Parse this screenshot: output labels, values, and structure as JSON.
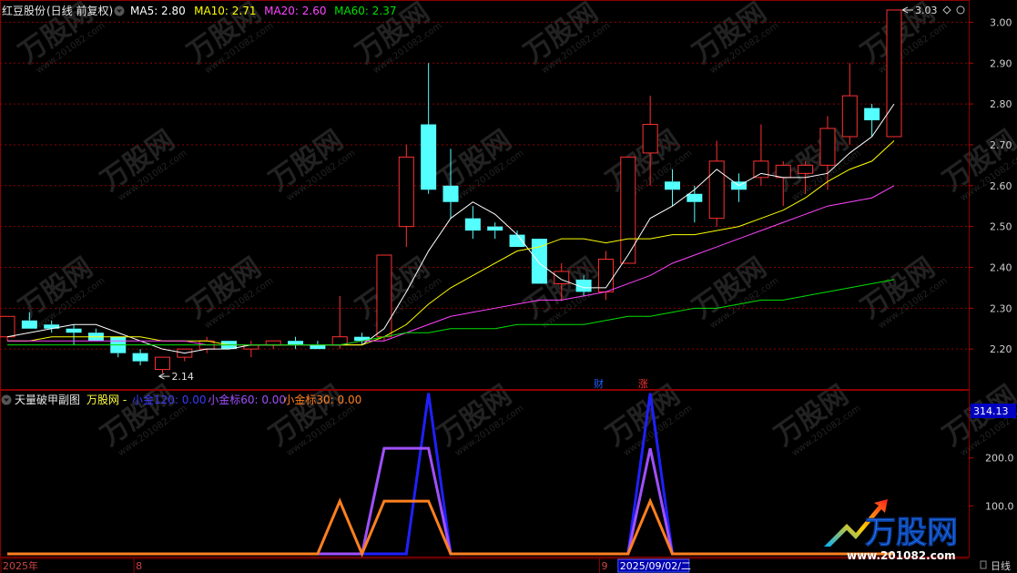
{
  "main_panel": {
    "stock_name": "红豆股份",
    "period_label": "(日线 前复权)",
    "ma_labels": [
      {
        "text": "MA5: 2.80",
        "color": "#ffffff"
      },
      {
        "text": "MA10: 2.71",
        "color": "#ffff00"
      },
      {
        "text": "MA20: 2.60",
        "color": "#ff44ff"
      },
      {
        "text": "MA60: 2.37",
        "color": "#00e000"
      }
    ],
    "high_marker": "3.03",
    "low_marker": "2.14",
    "event_badges": [
      {
        "text": "财",
        "candle_index": 26,
        "color": "#2060ff"
      },
      {
        "text": "涨",
        "candle_index": 28,
        "color": "#ff3030"
      }
    ]
  },
  "sub_panel": {
    "title": "天量破甲副图",
    "source": "万股网 -",
    "series_labels": [
      {
        "text": "小金120: 0.00",
        "color": "#3a3aff"
      },
      {
        "text": "小金标60: 0.00",
        "color": "#a050ff"
      },
      {
        "text": "小金标30: 0.00",
        "color": "#ff8020"
      }
    ],
    "value_badge": "314.13"
  },
  "x_axis": {
    "labels": [
      {
        "text": "2025年",
        "candle_index": 0
      },
      {
        "text": "8",
        "candle_index": 6
      },
      {
        "text": "9",
        "candle_index": 27
      }
    ],
    "cursor_label": "2025/09/02/二",
    "cursor_index": 28,
    "period_tag": "日线"
  },
  "watermark": {
    "brand": "万股网",
    "url": "www.201082.com"
  },
  "colors": {
    "up": "#ff3030",
    "down": "#54ffff",
    "grid": "#8b0000",
    "axis_text": "#d0d0d0"
  },
  "chart_data": [
    {
      "type": "candlestick",
      "title": "",
      "ylim": [
        2.1,
        3.05
      ],
      "y_ticks": [
        2.2,
        2.3,
        2.4,
        2.5,
        2.6,
        2.7,
        2.8,
        2.9,
        3.0
      ],
      "candles": [
        {
          "o": 2.23,
          "h": 2.28,
          "l": 2.22,
          "c": 2.28
        },
        {
          "o": 2.27,
          "h": 2.29,
          "l": 2.25,
          "c": 2.25
        },
        {
          "o": 2.26,
          "h": 2.27,
          "l": 2.24,
          "c": 2.25
        },
        {
          "o": 2.25,
          "h": 2.26,
          "l": 2.21,
          "c": 2.24
        },
        {
          "o": 2.24,
          "h": 2.25,
          "l": 2.22,
          "c": 2.22
        },
        {
          "o": 2.23,
          "h": 2.23,
          "l": 2.18,
          "c": 2.19
        },
        {
          "o": 2.19,
          "h": 2.2,
          "l": 2.16,
          "c": 2.17
        },
        {
          "o": 2.15,
          "h": 2.18,
          "l": 2.14,
          "c": 2.18
        },
        {
          "o": 2.18,
          "h": 2.2,
          "l": 2.17,
          "c": 2.2
        },
        {
          "o": 2.2,
          "h": 2.23,
          "l": 2.19,
          "c": 2.22
        },
        {
          "o": 2.22,
          "h": 2.22,
          "l": 2.2,
          "c": 2.2
        },
        {
          "o": 2.2,
          "h": 2.22,
          "l": 2.18,
          "c": 2.21
        },
        {
          "o": 2.21,
          "h": 2.22,
          "l": 2.2,
          "c": 2.22
        },
        {
          "o": 2.22,
          "h": 2.23,
          "l": 2.2,
          "c": 2.21
        },
        {
          "o": 2.21,
          "h": 2.22,
          "l": 2.2,
          "c": 2.2
        },
        {
          "o": 2.21,
          "h": 2.33,
          "l": 2.2,
          "c": 2.23
        },
        {
          "o": 2.23,
          "h": 2.24,
          "l": 2.21,
          "c": 2.22
        },
        {
          "o": 2.23,
          "h": 2.43,
          "l": 2.22,
          "c": 2.43
        },
        {
          "o": 2.5,
          "h": 2.7,
          "l": 2.45,
          "c": 2.67
        },
        {
          "o": 2.75,
          "h": 2.9,
          "l": 2.58,
          "c": 2.59
        },
        {
          "o": 2.6,
          "h": 2.69,
          "l": 2.52,
          "c": 2.56
        },
        {
          "o": 2.52,
          "h": 2.55,
          "l": 2.47,
          "c": 2.49
        },
        {
          "o": 2.5,
          "h": 2.51,
          "l": 2.47,
          "c": 2.49
        },
        {
          "o": 2.48,
          "h": 2.49,
          "l": 2.45,
          "c": 2.45
        },
        {
          "o": 2.47,
          "h": 2.47,
          "l": 2.36,
          "c": 2.36
        },
        {
          "o": 2.36,
          "h": 2.41,
          "l": 2.32,
          "c": 2.39
        },
        {
          "o": 2.37,
          "h": 2.38,
          "l": 2.33,
          "c": 2.34
        },
        {
          "o": 2.34,
          "h": 2.44,
          "l": 2.32,
          "c": 2.42
        },
        {
          "o": 2.41,
          "h": 2.67,
          "l": 2.41,
          "c": 2.67
        },
        {
          "o": 2.68,
          "h": 2.82,
          "l": 2.6,
          "c": 2.75
        },
        {
          "o": 2.61,
          "h": 2.64,
          "l": 2.55,
          "c": 2.59
        },
        {
          "o": 2.58,
          "h": 2.6,
          "l": 2.51,
          "c": 2.56
        },
        {
          "o": 2.52,
          "h": 2.71,
          "l": 2.5,
          "c": 2.66
        },
        {
          "o": 2.61,
          "h": 2.63,
          "l": 2.56,
          "c": 2.59
        },
        {
          "o": 2.62,
          "h": 2.75,
          "l": 2.6,
          "c": 2.66
        },
        {
          "o": 2.62,
          "h": 2.66,
          "l": 2.55,
          "c": 2.65
        },
        {
          "o": 2.63,
          "h": 2.66,
          "l": 2.58,
          "c": 2.65
        },
        {
          "o": 2.65,
          "h": 2.77,
          "l": 2.59,
          "c": 2.74
        },
        {
          "o": 2.72,
          "h": 2.9,
          "l": 2.7,
          "c": 2.82
        },
        {
          "o": 2.79,
          "h": 2.8,
          "l": 2.72,
          "c": 2.76
        },
        {
          "o": 2.72,
          "h": 3.03,
          "l": 2.72,
          "c": 3.03
        }
      ],
      "ma_series": [
        {
          "name": "MA5",
          "color": "#ffffff",
          "values": [
            2.23,
            2.24,
            2.25,
            2.26,
            2.26,
            2.24,
            2.22,
            2.2,
            2.19,
            2.2,
            2.2,
            2.21,
            2.21,
            2.21,
            2.21,
            2.21,
            2.21,
            2.25,
            2.34,
            2.44,
            2.52,
            2.56,
            2.53,
            2.48,
            2.41,
            2.37,
            2.35,
            2.35,
            2.43,
            2.52,
            2.55,
            2.59,
            2.64,
            2.6,
            2.63,
            2.62,
            2.62,
            2.63,
            2.68,
            2.72,
            2.8
          ]
        },
        {
          "name": "MA10",
          "color": "#ffff00",
          "values": [
            2.22,
            2.22,
            2.23,
            2.23,
            2.23,
            2.23,
            2.23,
            2.22,
            2.22,
            2.22,
            2.21,
            2.21,
            2.21,
            2.21,
            2.21,
            2.21,
            2.21,
            2.23,
            2.26,
            2.31,
            2.35,
            2.38,
            2.41,
            2.44,
            2.45,
            2.47,
            2.47,
            2.46,
            2.47,
            2.47,
            2.48,
            2.48,
            2.49,
            2.5,
            2.52,
            2.54,
            2.57,
            2.61,
            2.64,
            2.66,
            2.71
          ]
        },
        {
          "name": "MA20",
          "color": "#ff44ff",
          "values": [
            2.22,
            2.22,
            2.22,
            2.22,
            2.22,
            2.22,
            2.22,
            2.22,
            2.22,
            2.21,
            2.21,
            2.21,
            2.21,
            2.21,
            2.21,
            2.21,
            2.22,
            2.22,
            2.24,
            2.26,
            2.28,
            2.29,
            2.3,
            2.31,
            2.32,
            2.32,
            2.33,
            2.34,
            2.36,
            2.38,
            2.41,
            2.43,
            2.45,
            2.47,
            2.49,
            2.51,
            2.53,
            2.55,
            2.56,
            2.57,
            2.6
          ]
        },
        {
          "name": "MA60",
          "color": "#00e000",
          "values": [
            2.21,
            2.21,
            2.21,
            2.21,
            2.21,
            2.21,
            2.21,
            2.21,
            2.21,
            2.21,
            2.21,
            2.21,
            2.21,
            2.21,
            2.21,
            2.21,
            2.22,
            2.23,
            2.24,
            2.24,
            2.25,
            2.25,
            2.25,
            2.26,
            2.26,
            2.26,
            2.26,
            2.27,
            2.28,
            2.28,
            2.29,
            2.3,
            2.3,
            2.31,
            2.32,
            2.32,
            2.33,
            2.34,
            2.35,
            2.36,
            2.37
          ]
        }
      ]
    },
    {
      "type": "line",
      "title": "",
      "ylim": [
        0,
        340
      ],
      "y_ticks": [
        100,
        200,
        300
      ],
      "series": [
        {
          "name": "小金120",
          "color": "#2020ff",
          "values": [
            0,
            0,
            0,
            0,
            0,
            0,
            0,
            0,
            0,
            0,
            0,
            0,
            0,
            0,
            0,
            0,
            0,
            0,
            0,
            335,
            0,
            0,
            0,
            0,
            0,
            0,
            0,
            0,
            0,
            335,
            0,
            0,
            0,
            0,
            0,
            0,
            0,
            0,
            0,
            0,
            0
          ]
        },
        {
          "name": "小金标60",
          "color": "#a050ff",
          "values": [
            0,
            0,
            0,
            0,
            0,
            0,
            0,
            0,
            0,
            0,
            0,
            0,
            0,
            0,
            0,
            0,
            0,
            220,
            220,
            220,
            0,
            0,
            0,
            0,
            0,
            0,
            0,
            0,
            0,
            220,
            0,
            0,
            0,
            0,
            0,
            0,
            0,
            0,
            0,
            0,
            0
          ]
        },
        {
          "name": "小金标30",
          "color": "#ff8020",
          "values": [
            0,
            0,
            0,
            0,
            0,
            0,
            0,
            0,
            0,
            0,
            0,
            0,
            0,
            0,
            0,
            110,
            0,
            110,
            110,
            110,
            0,
            0,
            0,
            0,
            0,
            0,
            0,
            0,
            0,
            110,
            0,
            0,
            0,
            0,
            0,
            0,
            0,
            0,
            0,
            0,
            0
          ]
        }
      ]
    }
  ]
}
